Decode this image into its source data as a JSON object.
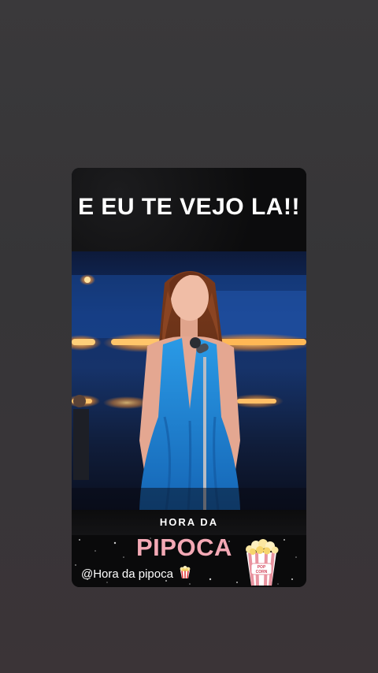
{
  "story": {
    "caption": "E EU TE VEJO LA!!",
    "banner": {
      "subtitle": "HORA DA",
      "title": "PIPOCA",
      "handle": "@Hora da pipoca",
      "popcorn_box_label": "POP CORN"
    }
  },
  "colors": {
    "background": "#383639",
    "title_pink": "#f4a9b5",
    "dress_blue": "#1d86d3"
  },
  "icons": {
    "handle_icon": "popcorn-icon",
    "logo_icon": "popcorn-box-icon"
  }
}
